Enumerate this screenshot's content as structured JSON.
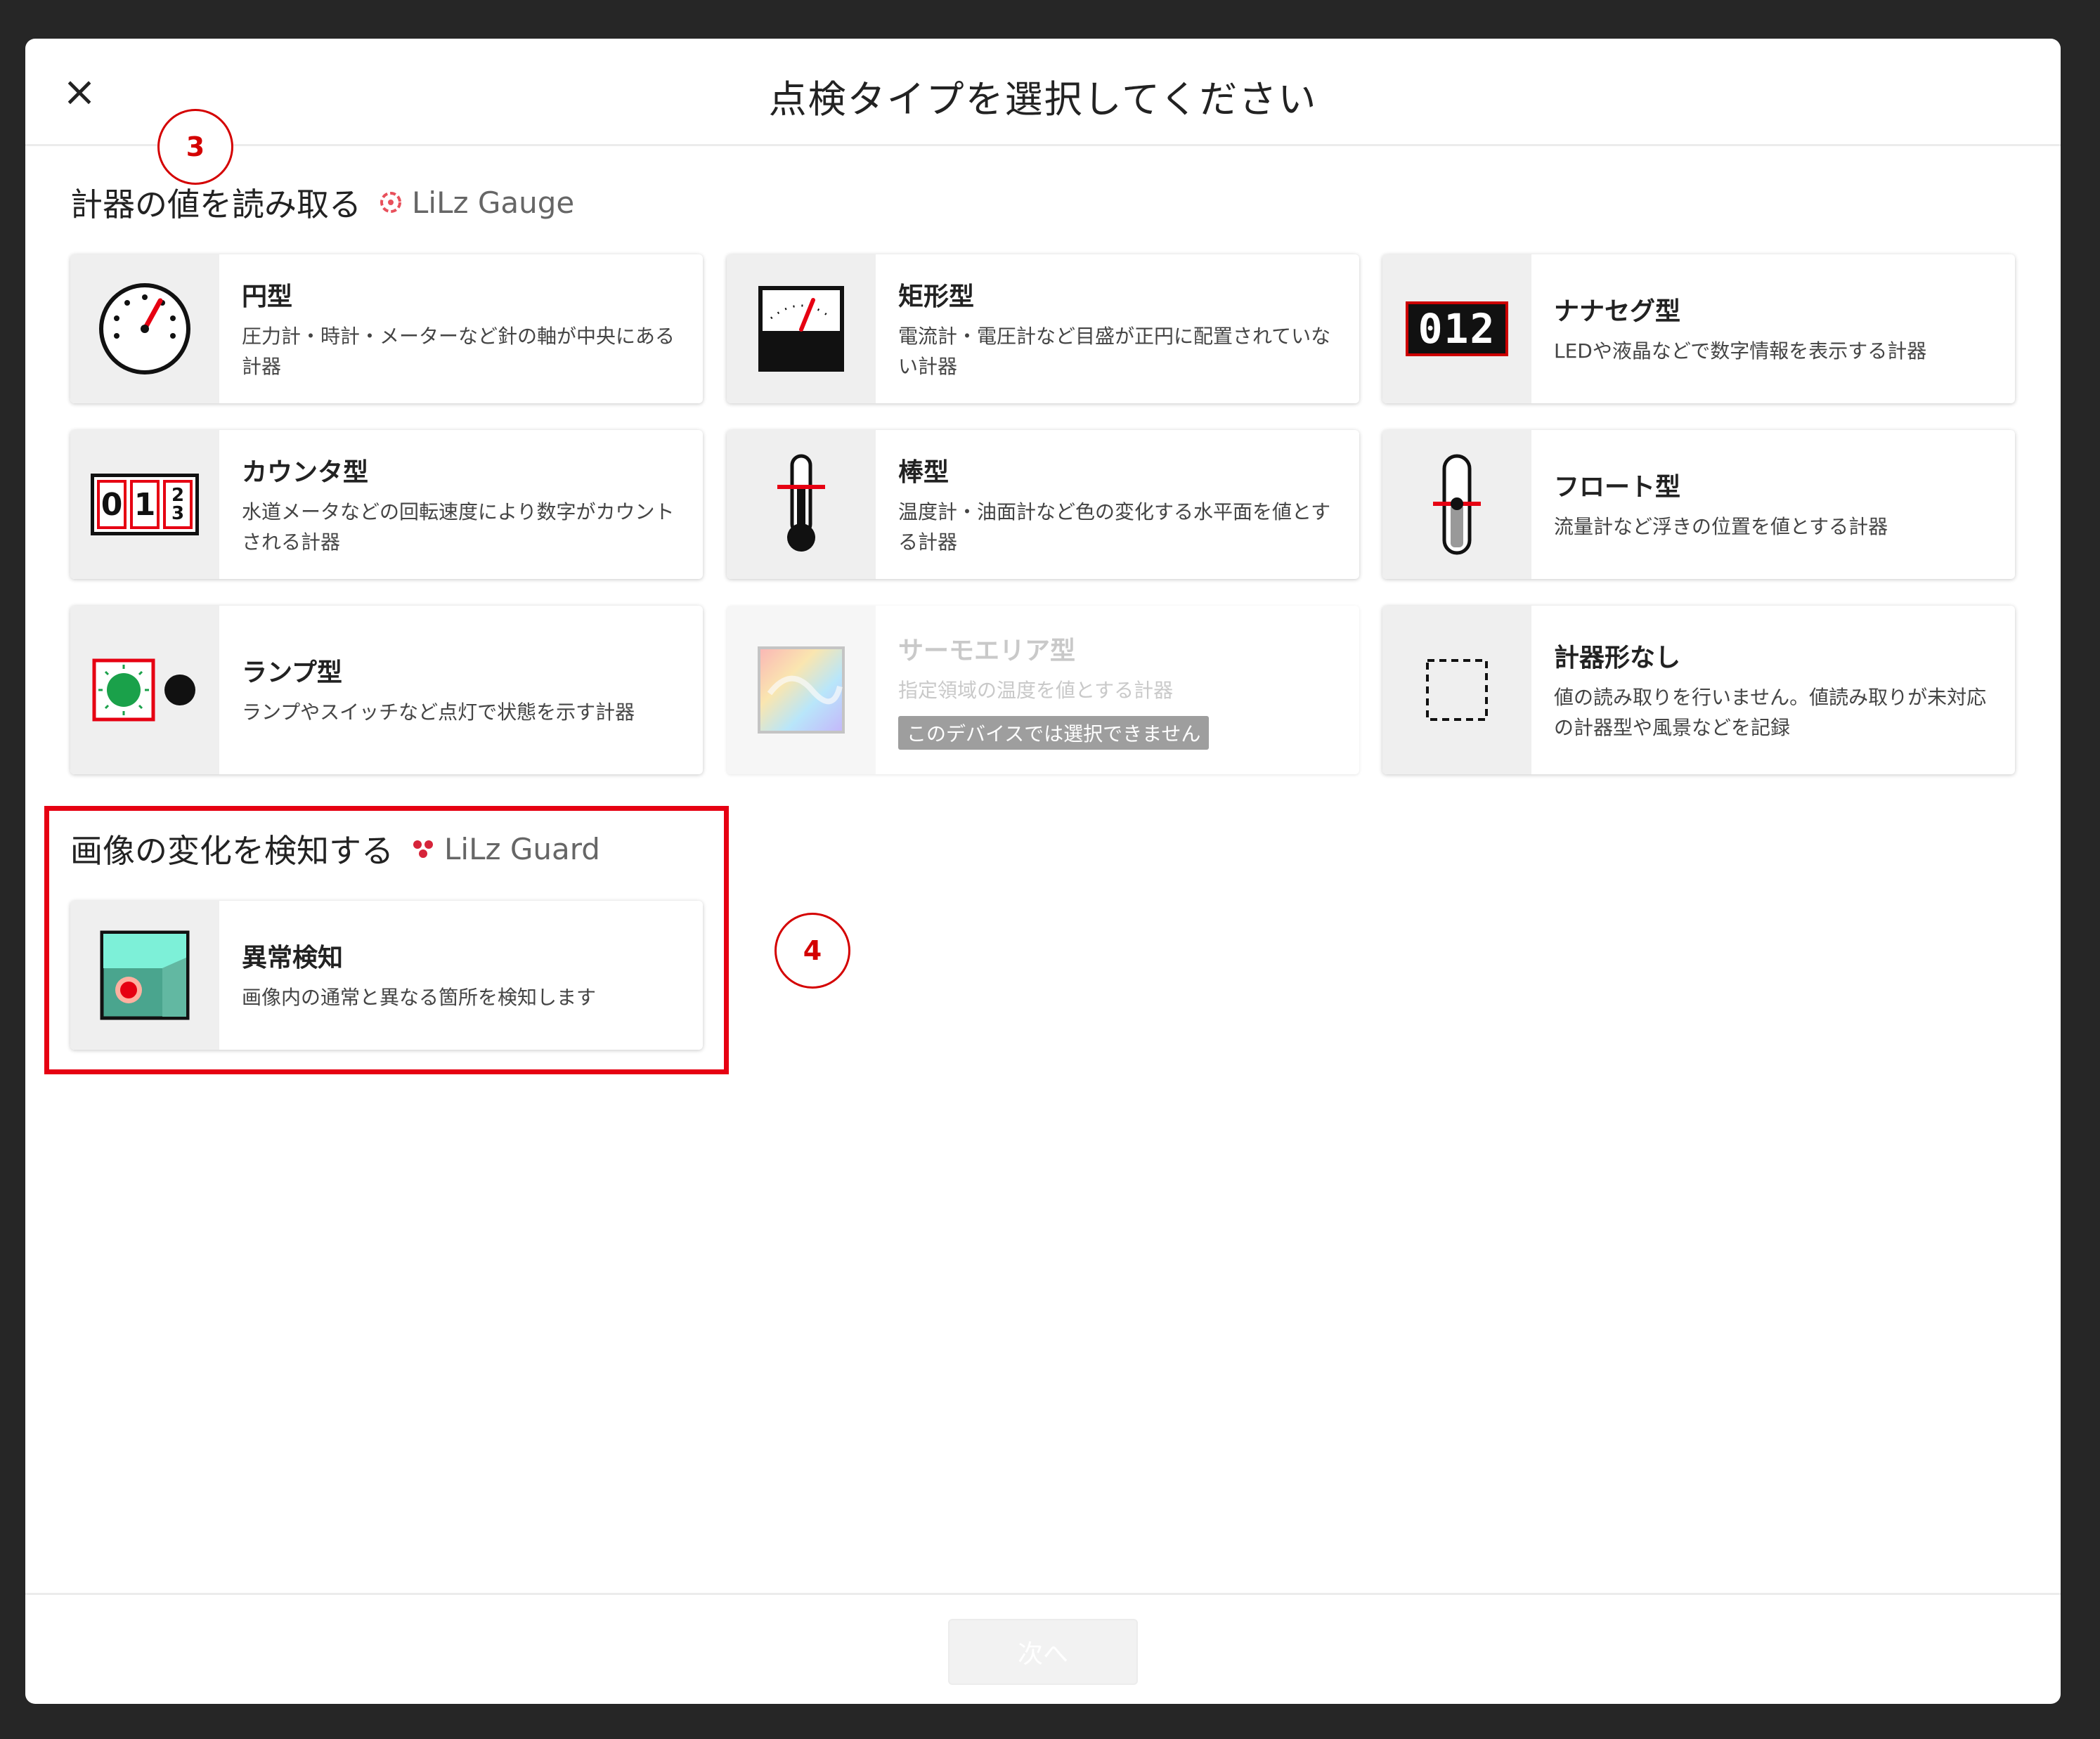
{
  "header": {
    "title": "点検タイプを選択してください",
    "close_icon": "×"
  },
  "section_gauge": {
    "title": "計器の値を読み取る",
    "brand": "LiLz Gauge"
  },
  "gauge_cards": [
    {
      "name": "円型",
      "desc": "圧力計・時計・メーターなど針の軸が中央にある計器",
      "icon": "round-gauge-icon"
    },
    {
      "name": "矩形型",
      "desc": "電流計・電圧計など目盛が正円に配置されていない計器",
      "icon": "rect-gauge-icon"
    },
    {
      "name": "ナナセグ型",
      "desc": "LEDや液晶などで数字情報を表示する計器",
      "icon": "seven-segment-icon",
      "digits": "012"
    },
    {
      "name": "カウンタ型",
      "desc": "水道メータなどの回転速度により数字がカウントされる計器",
      "icon": "counter-icon",
      "digits": [
        "0",
        "1",
        "2",
        "3"
      ]
    },
    {
      "name": "棒型",
      "desc": "温度計・油面計など色の変化する水平面を値とする計器",
      "icon": "thermometer-icon"
    },
    {
      "name": "フロート型",
      "desc": "流量計など浮きの位置を値とする計器",
      "icon": "float-icon"
    },
    {
      "name": "ランプ型",
      "desc": "ランプやスイッチなど点灯で状態を示す計器",
      "icon": "lamp-icon"
    },
    {
      "name": "サーモエリア型",
      "desc": "指定領域の温度を値とする計器",
      "icon": "thermal-area-icon",
      "disabled": true,
      "badge": "このデバイスでは選択できません"
    },
    {
      "name": "計器形なし",
      "desc": "値の読み取りを行いません。値読み取りが未対応の計器型や風景などを記録",
      "icon": "no-gauge-icon"
    }
  ],
  "section_guard": {
    "title": "画像の変化を検知する",
    "brand": "LiLz Guard"
  },
  "guard_cards": [
    {
      "name": "異常検知",
      "desc": "画像内の通常と異なる箇所を検知します",
      "icon": "anomaly-detection-icon"
    }
  ],
  "annotations": {
    "step3": "3",
    "step4": "4"
  },
  "footer": {
    "next_label": "次へ"
  },
  "colors": {
    "accent_red": "#e60012",
    "gauge_brand": "#e8505b",
    "guard_brand": "#d6243a"
  }
}
